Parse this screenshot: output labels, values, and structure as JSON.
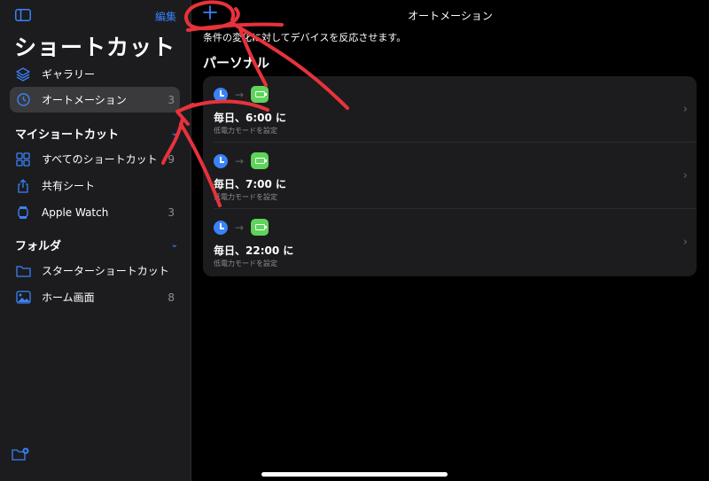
{
  "sidebar": {
    "edit_label": "編集",
    "title": "ショートカット",
    "items": [
      {
        "label": "ギャラリー",
        "icon": "layers-icon",
        "count": ""
      },
      {
        "label": "オートメーション",
        "icon": "automation-clock-icon",
        "count": "3"
      }
    ],
    "my_shortcuts": {
      "heading": "マイショートカット",
      "items": [
        {
          "label": "すべてのショートカット",
          "icon": "grid-icon",
          "count": "9"
        },
        {
          "label": "共有シート",
          "icon": "share-icon",
          "count": ""
        },
        {
          "label": "Apple Watch",
          "icon": "watch-icon",
          "count": "3"
        }
      ]
    },
    "folders": {
      "heading": "フォルダ",
      "items": [
        {
          "label": "スターターショートカット",
          "icon": "folder-icon",
          "count": ""
        },
        {
          "label": "ホーム画面",
          "icon": "photo-icon",
          "count": "8"
        }
      ]
    }
  },
  "main": {
    "nav_title": "オートメーション",
    "description": "条件の変化に対してデバイスを反応させます。",
    "section_title": "パーソナル",
    "automations": [
      {
        "title": "毎日、6:00 に",
        "subtitle": "低電力モードを設定"
      },
      {
        "title": "毎日、7:00 に",
        "subtitle": "低電力モードを設定"
      },
      {
        "title": "毎日、22:00 に",
        "subtitle": "低電力モードを設定"
      }
    ]
  },
  "colors": {
    "accent": "#3a82f7",
    "sidebar_bg": "#1c1c1e",
    "active_bg": "#3a3a3c",
    "battery_tile": "#5fd35b",
    "annotation": "#e8323c"
  }
}
